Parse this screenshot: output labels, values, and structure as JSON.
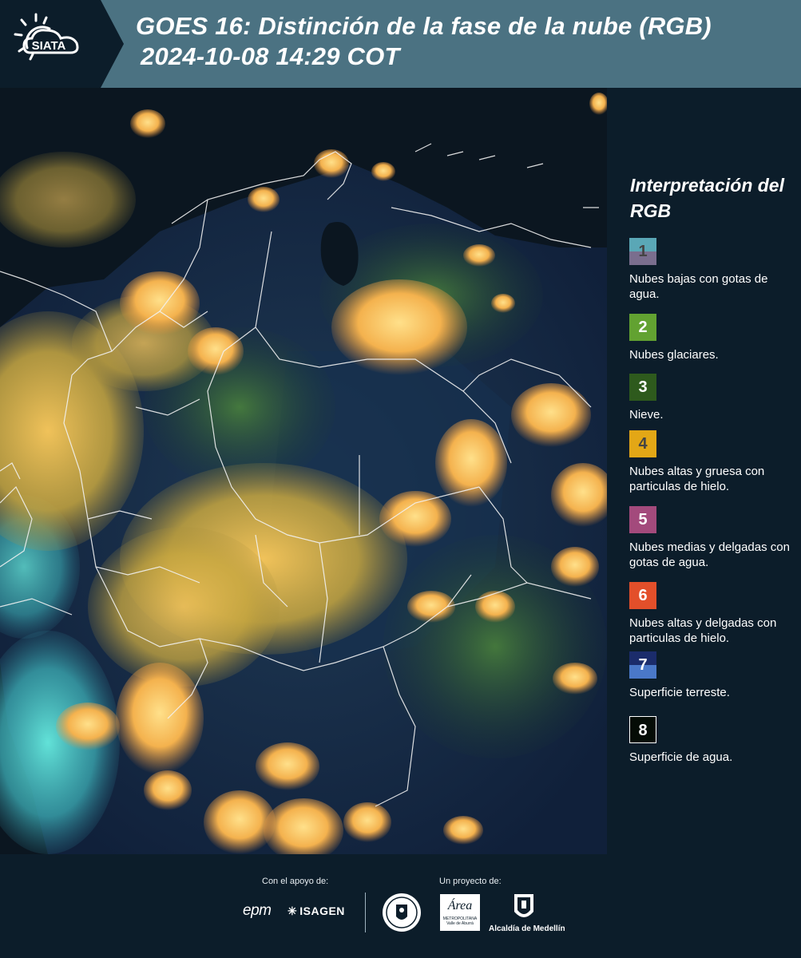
{
  "header": {
    "logo_text": "SIATA",
    "title_line1": "GOES 16: Distinción de la fase de la nube (RGB)",
    "title_line2": "2024-10-08 14:29 COT"
  },
  "legend": {
    "title": "Interpretación del RGB",
    "items": [
      {
        "number": "1",
        "text": "Nubes bajas con gotas de agua.",
        "color_top": "#5aa7b6",
        "color_bottom": "#7a6e8e",
        "number_color": "#444444"
      },
      {
        "number": "2",
        "text": "Nubes glaciares.",
        "color_top": "#62a231",
        "color_bottom": "#62a231",
        "number_color": "#ffffff"
      },
      {
        "number": "3",
        "text": "Nieve.",
        "color_top": "#2e5a1d",
        "color_bottom": "#2e5a1d",
        "number_color": "#ffffff"
      },
      {
        "number": "4",
        "text": "Nubes altas y gruesa con particulas de hielo.",
        "color_top": "#e3a716",
        "color_bottom": "#e3a716",
        "number_color": "#444444"
      },
      {
        "number": "5",
        "text": "Nubes medias y delgadas con gotas de agua.",
        "color_top": "#a34a7c",
        "color_bottom": "#a34a7c",
        "number_color": "#ffffff"
      },
      {
        "number": "6",
        "text": "Nubes altas y delgadas con particulas de hielo.",
        "color_top": "#e34f2a",
        "color_bottom": "#e34f2a",
        "number_color": "#ffffff"
      },
      {
        "number": "7",
        "text": "Superficie terreste.",
        "color_top": "#1b2c6b",
        "color_bottom": "#4a78c8",
        "number_color": "#ffffff"
      },
      {
        "number": "8",
        "text": "Superficie de agua.",
        "color_top": "#050c06",
        "color_bottom": "#050c06",
        "number_color": "#ffffff"
      }
    ]
  },
  "footer": {
    "support_label": "Con el apoyo de:",
    "project_label": "Un proyecto de:",
    "sponsor1": "epm",
    "sponsor2": "ISAGEN",
    "partner1": "Área",
    "partner1_sub": "METROPOLITANA Valle de Aburrá",
    "partner2": "Alcaldía de Medellín"
  }
}
